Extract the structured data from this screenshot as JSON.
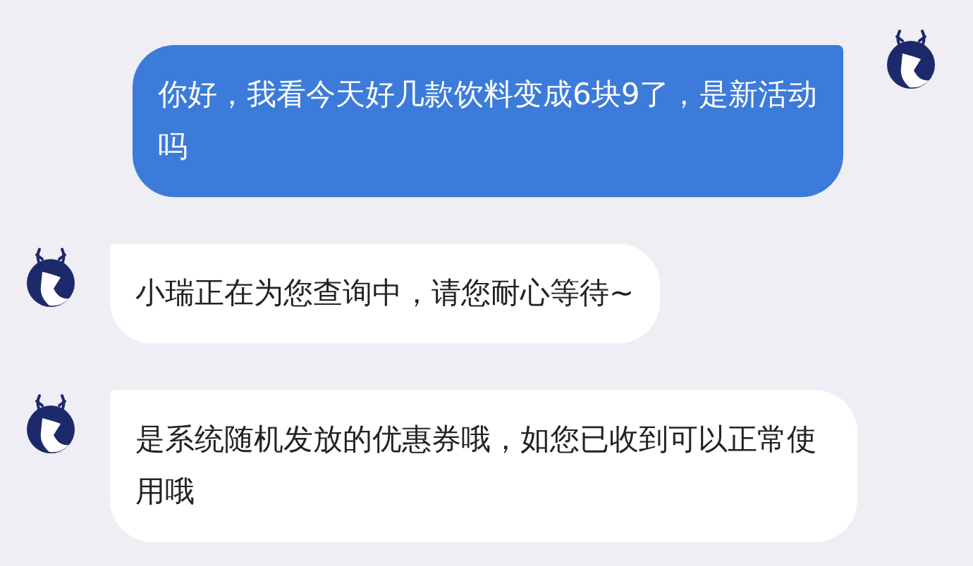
{
  "messages": [
    {
      "kind": "sent",
      "text": "你好，我看今天好几款饮料变成6块9了，是新活动吗"
    },
    {
      "kind": "received",
      "text": "小瑞正在为您查询中，请您耐心等待~"
    },
    {
      "kind": "received",
      "text": "是系统随机发放的优惠券哦，如您已收到可以正常使用哦"
    }
  ]
}
